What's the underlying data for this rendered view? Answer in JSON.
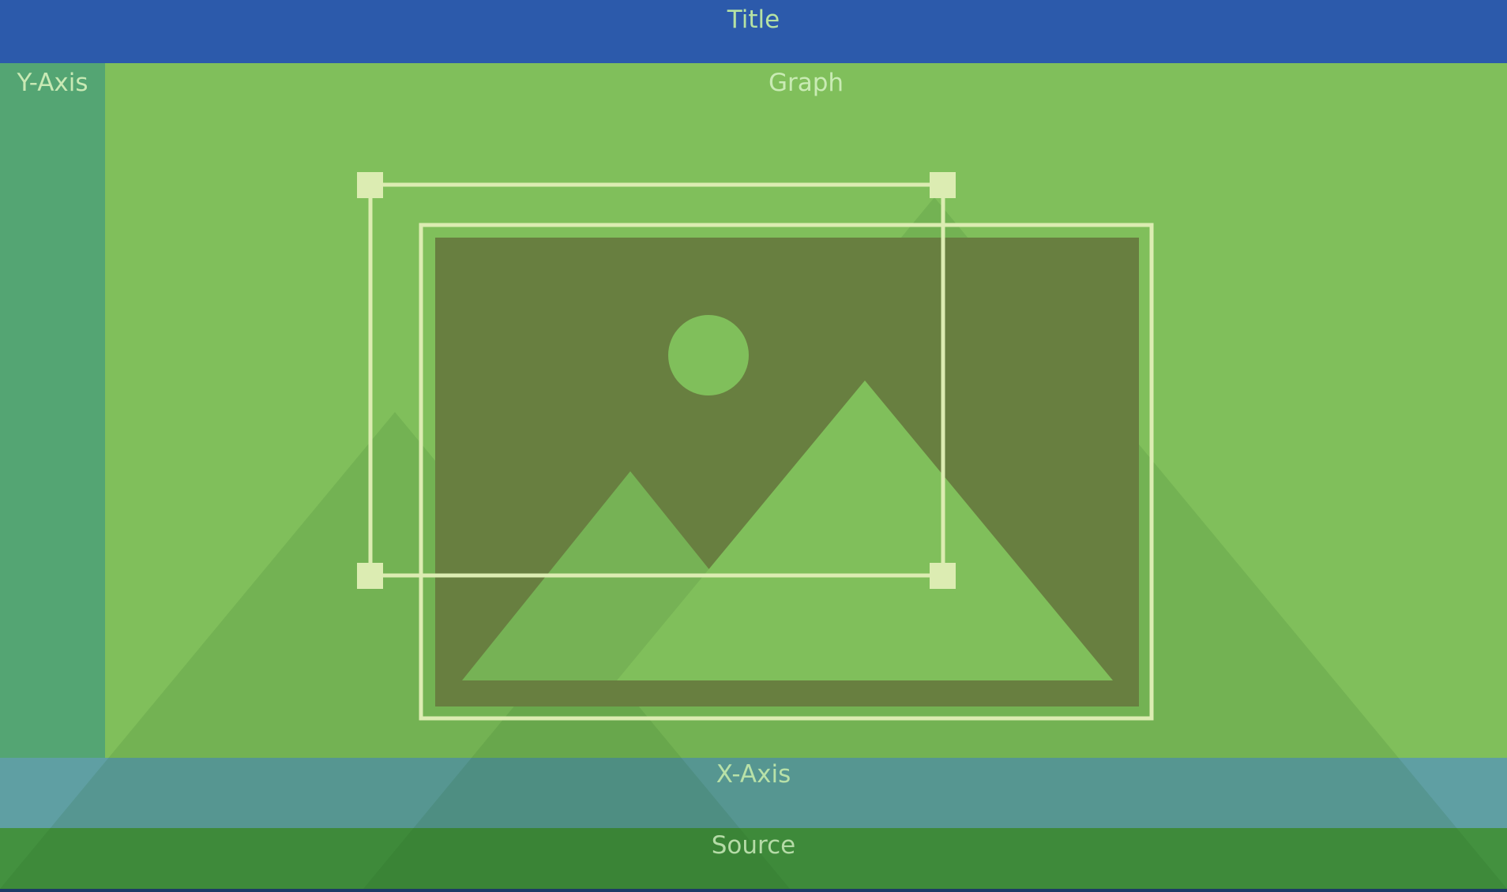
{
  "regions": {
    "title": "Title",
    "y_axis": "Y-Axis",
    "graph": "Graph",
    "x_axis": "X-Axis",
    "source": "Source"
  },
  "colors": {
    "title_band": "#2c5aab",
    "y_axis_band": "#54a573",
    "graph_area": "#80bf5b",
    "x_axis_band": "#5f9fa3",
    "source_band": "#43913f",
    "image_fill": "#687f40",
    "outline": "#dcecb2",
    "bottom_strip": "#1d3b66"
  },
  "icons": {
    "placeholder": "image-placeholder-icon",
    "selection": "selection-box-icon"
  }
}
